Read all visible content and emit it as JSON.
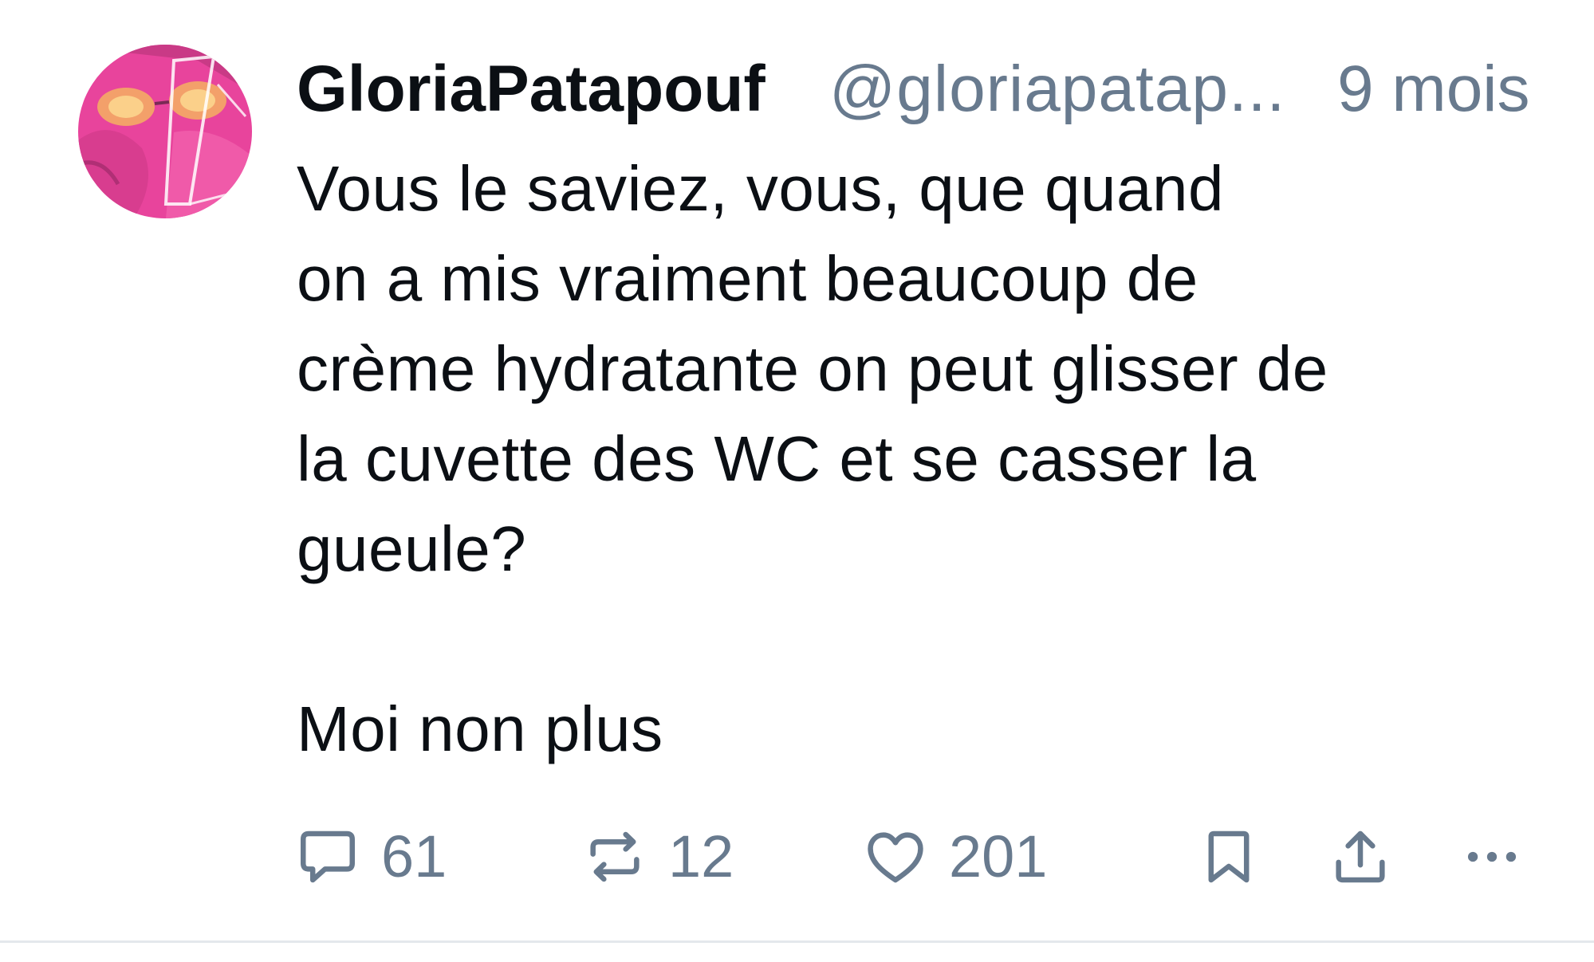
{
  "post": {
    "author": {
      "display_name": "GloriaPatapouf",
      "handle": "@gloriapatap...",
      "avatar_icon": "avatar-image"
    },
    "timestamp": "9 mois",
    "body_lines": [
      "Vous le saviez, vous, que quand",
      "on a mis vraiment beaucoup de",
      "crème hydratante on peut glisser de",
      "la cuvette des WC et se casser la",
      "gueule?",
      "",
      "Moi non plus"
    ],
    "actions": {
      "reply": {
        "icon": "comment-icon",
        "count": "61"
      },
      "repost": {
        "icon": "repost-icon",
        "count": "12"
      },
      "like": {
        "icon": "heart-icon",
        "count": "201"
      },
      "bookmark": {
        "icon": "bookmark-icon"
      },
      "share": {
        "icon": "share-icon"
      },
      "more": {
        "icon": "more-icon"
      }
    }
  },
  "colors": {
    "text": "#0b0f14",
    "muted": "#687a8e",
    "avatar_pink": "#e8449c",
    "divider": "#e4e8ec"
  }
}
